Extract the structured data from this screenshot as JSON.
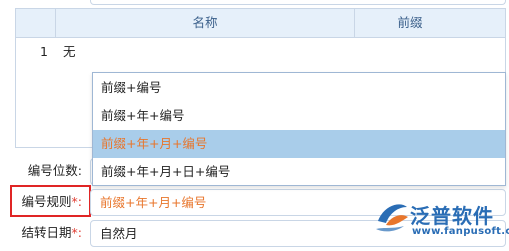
{
  "grid": {
    "headers": {
      "name": "名称",
      "prefix": "前缀"
    },
    "rows": [
      {
        "num": "1",
        "name": "无"
      }
    ]
  },
  "form": {
    "digits_label": "编号位数:",
    "rule_label": "编号规则",
    "rule_required": "*:",
    "rule_value": "前缀+年+月+编号",
    "date_label": "结转日期",
    "date_required": "*:",
    "date_value": "自然月"
  },
  "dropdown": {
    "options": [
      "前缀+编号",
      "前缀+年+编号",
      "前缀+年+月+编号",
      "前缀+年+月+日+编号"
    ],
    "selected_index": 2
  },
  "logo": {
    "name": "泛普软件",
    "url": "www.fanpusoft.com"
  },
  "colors": {
    "accent": "#e8762c",
    "selected_bg": "#a9cdea",
    "highlight": "#e02525",
    "brand": "#2a6db5"
  }
}
